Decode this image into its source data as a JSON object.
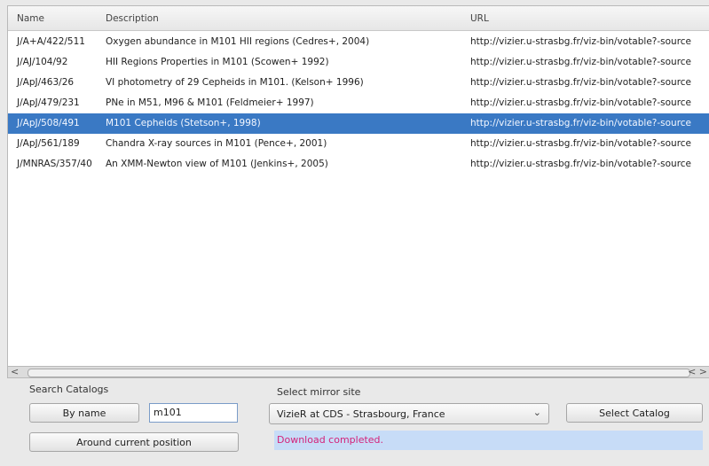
{
  "table": {
    "headers": {
      "name": "Name",
      "description": "Description",
      "url": "URL"
    },
    "rows": [
      {
        "name": "J/A+A/422/511",
        "description": "Oxygen abundance in M101 HII regions (Cedres+, 2004)",
        "url": "http://vizier.u-strasbg.fr/viz-bin/votable?-source"
      },
      {
        "name": "J/AJ/104/92",
        "description": "HII Regions Properties in M101 (Scowen+ 1992)",
        "url": "http://vizier.u-strasbg.fr/viz-bin/votable?-source"
      },
      {
        "name": "J/ApJ/463/26",
        "description": "VI photometry of 29 Cepheids in M101. (Kelson+ 1996)",
        "url": "http://vizier.u-strasbg.fr/viz-bin/votable?-source"
      },
      {
        "name": "J/ApJ/479/231",
        "description": "PNe in M51, M96 & M101 (Feldmeier+ 1997)",
        "url": "http://vizier.u-strasbg.fr/viz-bin/votable?-source"
      },
      {
        "name": "J/ApJ/508/491",
        "description": "M101 Cepheids (Stetson+, 1998)",
        "url": "http://vizier.u-strasbg.fr/viz-bin/votable?-source"
      },
      {
        "name": "J/ApJ/561/189",
        "description": "Chandra X-ray sources in M101 (Pence+, 2001)",
        "url": "http://vizier.u-strasbg.fr/viz-bin/votable?-source"
      },
      {
        "name": "J/MNRAS/357/40",
        "description": "An XMM-Newton view of M101 (Jenkins+, 2005)",
        "url": "http://vizier.u-strasbg.fr/viz-bin/votable?-source"
      }
    ],
    "selected_row": "J/ApJ/508/491"
  },
  "search": {
    "section_label": "Search Catalogs",
    "by_name_label": "By name",
    "query_value": "m101",
    "around_position_label": "Around current position"
  },
  "mirror": {
    "section_label": "Select mirror site",
    "selected": "VizieR at CDS - Strasbourg, France",
    "select_catalog_label": "Select Catalog"
  },
  "status": {
    "text": "Download completed."
  },
  "colors": {
    "selection": "#3a79c4",
    "status_bg": "#c7dcf7",
    "status_text": "#d4237a"
  },
  "icons": {
    "scroll_left": "chevron-left-icon",
    "scroll_right": "chevron-left-right-icon",
    "dropdown": "chevron-down-icon"
  }
}
